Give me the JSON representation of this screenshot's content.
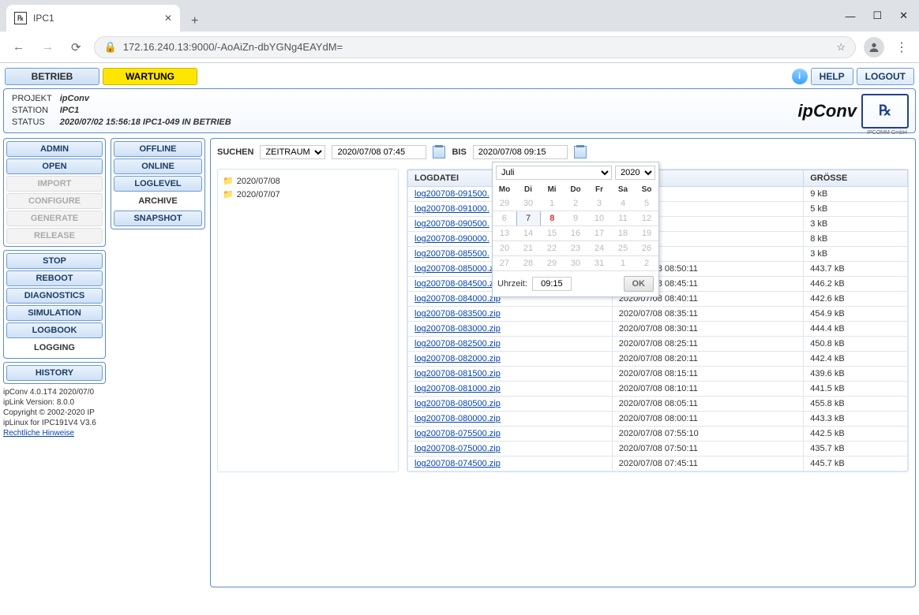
{
  "browser": {
    "tab_title": "IPC1",
    "url": "172.16.240.13:9000/-AoAiZn-dbYGNg4EAYdM="
  },
  "topbar": {
    "betrieb": "BETRIEB",
    "wartung": "WARTUNG",
    "help": "HELP",
    "logout": "LOGOUT"
  },
  "header": {
    "projekt_label": "PROJEKT",
    "projekt": "ipConv",
    "station_label": "STATION",
    "station": "IPC1",
    "status_label": "STATUS",
    "status": "2020/07/02 15:56:18 IPC1-049 IN BETRIEB",
    "brand": "ipConv",
    "logo": "℞",
    "logo_sub": "IPCOMM GmbH"
  },
  "sidebar": {
    "items": [
      {
        "label": "ADMIN",
        "state": "enabled"
      },
      {
        "label": "OPEN",
        "state": "enabled"
      },
      {
        "label": "IMPORT",
        "state": "disabled"
      },
      {
        "label": "CONFIGURE",
        "state": "disabled"
      },
      {
        "label": "GENERATE",
        "state": "disabled"
      },
      {
        "label": "RELEASE",
        "state": "disabled"
      }
    ],
    "ops": [
      {
        "label": "STOP",
        "state": "enabled"
      },
      {
        "label": "REBOOT",
        "state": "enabled"
      },
      {
        "label": "DIAGNOSTICS",
        "state": "enabled"
      },
      {
        "label": "SIMULATION",
        "state": "enabled"
      },
      {
        "label": "LOGBOOK",
        "state": "enabled"
      },
      {
        "label": "LOGGING",
        "state": "flat"
      }
    ],
    "hist": [
      {
        "label": "HISTORY",
        "state": "enabled"
      }
    ],
    "footer": {
      "l1": "ipConv 4.0.1T4 2020/07/0",
      "l2": "ipLink Version: 8.0.0",
      "l3": "Copyright © 2002-2020 IP",
      "l4": "ipLinux for IPC191V4 V3.6",
      "link": "Rechtliche Hinweise"
    }
  },
  "subnav": [
    {
      "label": "OFFLINE",
      "state": "enabled"
    },
    {
      "label": "ONLINE",
      "state": "enabled"
    },
    {
      "label": "LOGLEVEL",
      "state": "enabled"
    },
    {
      "label": "ARCHIVE",
      "state": "flat"
    },
    {
      "label": "SNAPSHOT",
      "state": "enabled"
    }
  ],
  "search": {
    "label": "SUCHEN",
    "mode": "ZEITRAUM",
    "from": "2020/07/08 07:45",
    "bis_label": "BIS",
    "to": "2020/07/08 09:15"
  },
  "folders": [
    "2020/07/08",
    "2020/07/07"
  ],
  "table": {
    "headers": [
      "LOGDATEI",
      "",
      "GRÖSSE"
    ],
    "rows": [
      {
        "file": "log200708-091500.",
        "date": "",
        "size": "9 kB"
      },
      {
        "file": "log200708-091000.",
        "date": "",
        "size": "5 kB"
      },
      {
        "file": "log200708-090500.",
        "date": "",
        "size": "3 kB"
      },
      {
        "file": "log200708-090000.",
        "date": "",
        "size": "8 kB"
      },
      {
        "file": "log200708-085500.",
        "date": "",
        "size": "3 kB"
      },
      {
        "file": "log200708-085000.zip",
        "date": "2020/07/08 08:50:11",
        "size": "443.7 kB"
      },
      {
        "file": "log200708-084500.zip",
        "date": "2020/07/08 08:45:11",
        "size": "446.2 kB"
      },
      {
        "file": "log200708-084000.zip",
        "date": "2020/07/08 08:40:11",
        "size": "442.6 kB"
      },
      {
        "file": "log200708-083500.zip",
        "date": "2020/07/08 08:35:11",
        "size": "454.9 kB"
      },
      {
        "file": "log200708-083000.zip",
        "date": "2020/07/08 08:30:11",
        "size": "444.4 kB"
      },
      {
        "file": "log200708-082500.zip",
        "date": "2020/07/08 08:25:11",
        "size": "450.8 kB"
      },
      {
        "file": "log200708-082000.zip",
        "date": "2020/07/08 08:20:11",
        "size": "442.4 kB"
      },
      {
        "file": "log200708-081500.zip",
        "date": "2020/07/08 08:15:11",
        "size": "439.6 kB"
      },
      {
        "file": "log200708-081000.zip",
        "date": "2020/07/08 08:10:11",
        "size": "441.5 kB"
      },
      {
        "file": "log200708-080500.zip",
        "date": "2020/07/08 08:05:11",
        "size": "455.8 kB"
      },
      {
        "file": "log200708-080000.zip",
        "date": "2020/07/08 08:00:11",
        "size": "443.3 kB"
      },
      {
        "file": "log200708-075500.zip",
        "date": "2020/07/08 07:55:10",
        "size": "442.5 kB"
      },
      {
        "file": "log200708-075000.zip",
        "date": "2020/07/08 07:50:11",
        "size": "435.7 kB"
      },
      {
        "file": "log200708-074500.zip",
        "date": "2020/07/08 07:45:11",
        "size": "445.7 kB"
      }
    ]
  },
  "calendar": {
    "month": "Juli",
    "year": "2020",
    "dayhead": [
      "Mo",
      "Di",
      "Mi",
      "Do",
      "Fr",
      "Sa",
      "So"
    ],
    "weeks": [
      [
        {
          "n": "29"
        },
        {
          "n": "30"
        },
        {
          "n": "1"
        },
        {
          "n": "2"
        },
        {
          "n": "3"
        },
        {
          "n": "4"
        },
        {
          "n": "5"
        }
      ],
      [
        {
          "n": "6"
        },
        {
          "n": "7",
          "in": true,
          "sel": true
        },
        {
          "n": "8",
          "in": true,
          "today": true
        },
        {
          "n": "9"
        },
        {
          "n": "10"
        },
        {
          "n": "11"
        },
        {
          "n": "12"
        }
      ],
      [
        {
          "n": "13"
        },
        {
          "n": "14"
        },
        {
          "n": "15"
        },
        {
          "n": "16"
        },
        {
          "n": "17"
        },
        {
          "n": "18"
        },
        {
          "n": "19"
        }
      ],
      [
        {
          "n": "20"
        },
        {
          "n": "21"
        },
        {
          "n": "22"
        },
        {
          "n": "23"
        },
        {
          "n": "24"
        },
        {
          "n": "25"
        },
        {
          "n": "26"
        }
      ],
      [
        {
          "n": "27"
        },
        {
          "n": "28"
        },
        {
          "n": "29"
        },
        {
          "n": "30"
        },
        {
          "n": "31"
        },
        {
          "n": "1"
        },
        {
          "n": "2"
        }
      ]
    ],
    "time_label": "Uhrzeit:",
    "time": "09:15",
    "ok": "OK"
  }
}
